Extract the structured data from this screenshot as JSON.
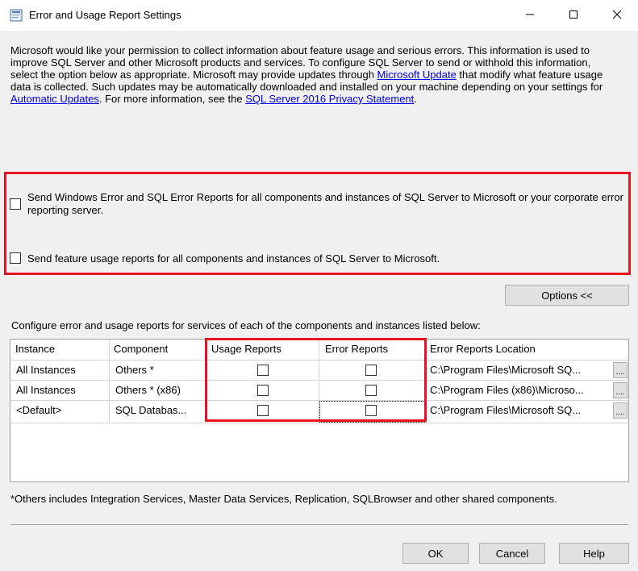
{
  "window": {
    "title": "Error and Usage Report Settings",
    "minimize_label": "—",
    "maximize_label": "☐",
    "close_label": "✕"
  },
  "intro": {
    "text1": "Microsoft would like your permission to collect information about feature usage and serious errors. This information is used to improve SQL Server and other Microsoft products and services.  To configure SQL Server to send or withhold this information, select the option below as appropriate. Microsoft may provide updates through ",
    "link1": "Microsoft Update",
    "text2": " that modify what feature usage data is collected.  Such updates may be automatically downloaded and installed on your machine depending on your settings for ",
    "link2": "Automatic Updates",
    "text3": ". For more information, see the ",
    "link3": "SQL Server 2016 Privacy Statement",
    "text4": "."
  },
  "options": {
    "error_reports": {
      "label": "Send Windows Error and SQL Error Reports for all components and instances of SQL Server to Microsoft or your corporate error reporting server.",
      "checked": false
    },
    "usage_reports": {
      "label": "Send feature usage reports for all components and instances of SQL Server to Microsoft.",
      "checked": false
    }
  },
  "options_button": "Options <<",
  "configure_label": "Configure error and usage reports for services of each of the components and instances listed below:",
  "grid": {
    "headers": {
      "instance": "Instance",
      "component": "Component",
      "usage": "Usage Reports",
      "error": "Error Reports",
      "location": "Error Reports Location"
    },
    "rows": [
      {
        "instance": "All Instances",
        "component": "Others *",
        "usage": false,
        "error": false,
        "location": "C:\\Program Files\\Microsoft SQ...",
        "browse": "...."
      },
      {
        "instance": "All Instances",
        "component": "Others * (x86)",
        "usage": false,
        "error": false,
        "location": "C:\\Program Files (x86)\\Microso...",
        "browse": "...."
      },
      {
        "instance": "<Default>",
        "component": "SQL Databas...",
        "usage": false,
        "error": false,
        "location": "C:\\Program Files\\Microsoft SQ...",
        "browse": "...."
      }
    ]
  },
  "footnote": "*Others includes Integration Services, Master Data Services, Replication, SQLBrowser and other shared components.",
  "buttons": {
    "ok": "OK",
    "cancel": "Cancel",
    "help": "Help"
  },
  "colors": {
    "highlight_border": "#e8141f",
    "link": "#0000ee",
    "window_bg": "#f0f0f0"
  }
}
